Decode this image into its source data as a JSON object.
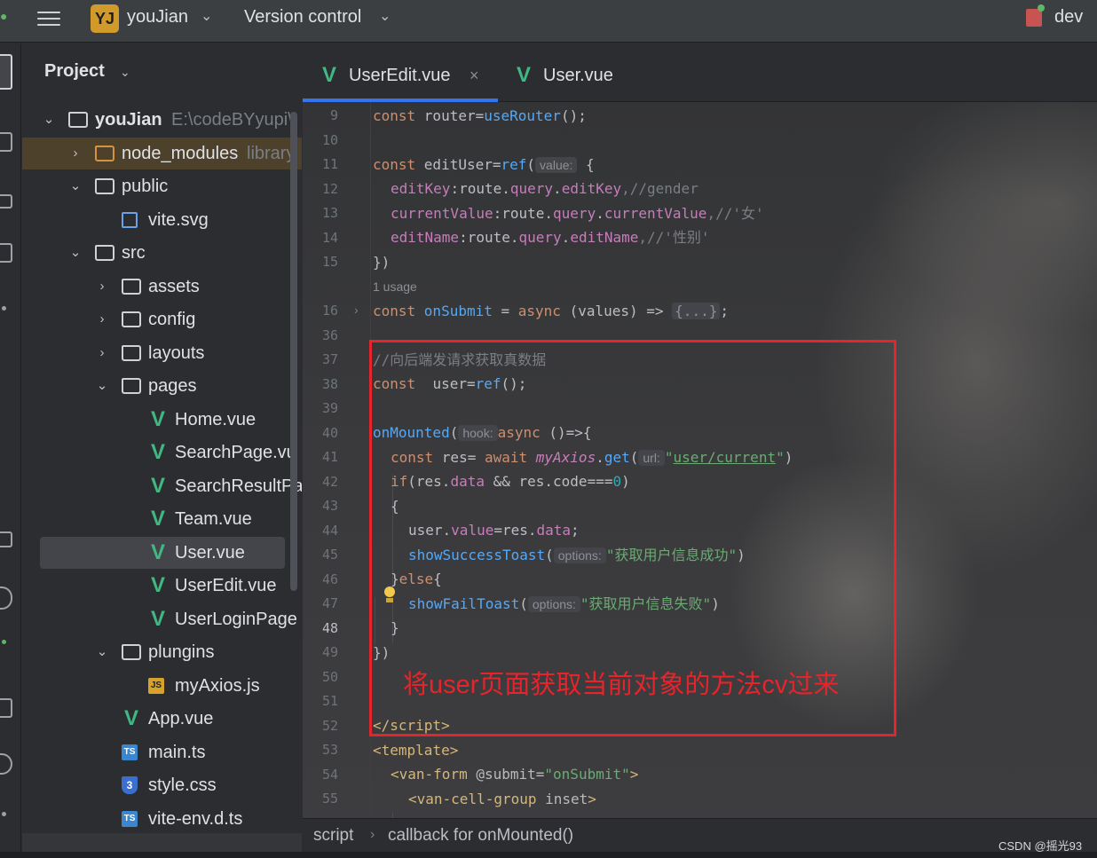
{
  "titlebar": {
    "project_initials": "YJ",
    "project_name": "youJian",
    "vcs_menu": "Version control",
    "branch": "dev"
  },
  "project_panel": {
    "title": "Project",
    "tree": [
      {
        "label": "youJian",
        "hint": "E:\\codeBYyupi\\",
        "type": "folder",
        "depth": 0,
        "expanded": true,
        "bold": true
      },
      {
        "label": "node_modules",
        "hint": "library",
        "type": "folder-excluded",
        "depth": 1,
        "expanded": false
      },
      {
        "label": "public",
        "type": "folder",
        "depth": 1,
        "expanded": true
      },
      {
        "label": "vite.svg",
        "type": "svg",
        "depth": 2
      },
      {
        "label": "src",
        "type": "folder",
        "depth": 1,
        "expanded": true
      },
      {
        "label": "assets",
        "type": "folder",
        "depth": 2,
        "expanded": false
      },
      {
        "label": "config",
        "type": "folder",
        "depth": 2,
        "expanded": false
      },
      {
        "label": "layouts",
        "type": "folder",
        "depth": 2,
        "expanded": false
      },
      {
        "label": "pages",
        "type": "folder",
        "depth": 2,
        "expanded": true
      },
      {
        "label": "Home.vue",
        "type": "vue",
        "depth": 3
      },
      {
        "label": "SearchPage.vu",
        "type": "vue",
        "depth": 3
      },
      {
        "label": "SearchResultPa",
        "type": "vue",
        "depth": 3
      },
      {
        "label": "Team.vue",
        "type": "vue",
        "depth": 3
      },
      {
        "label": "User.vue",
        "type": "vue",
        "depth": 3,
        "selected": true
      },
      {
        "label": "UserEdit.vue",
        "type": "vue",
        "depth": 3
      },
      {
        "label": "UserLoginPage",
        "type": "vue",
        "depth": 3
      },
      {
        "label": "plungins",
        "type": "folder",
        "depth": 2,
        "expanded": true
      },
      {
        "label": "myAxios.js",
        "type": "js",
        "depth": 3
      },
      {
        "label": "App.vue",
        "type": "vue",
        "depth": 2
      },
      {
        "label": "main.ts",
        "type": "ts",
        "depth": 2
      },
      {
        "label": "style.css",
        "type": "css",
        "depth": 2
      },
      {
        "label": "vite-env.d.ts",
        "type": "ts",
        "depth": 2
      }
    ]
  },
  "tabs": [
    {
      "label": "UserEdit.vue",
      "active": true,
      "close": "×"
    },
    {
      "label": "User.vue",
      "active": false
    }
  ],
  "editor": {
    "line_numbers": [
      "9",
      "10",
      "11",
      "12",
      "13",
      "14",
      "15",
      "",
      "16",
      "36",
      "37",
      "38",
      "39",
      "40",
      "41",
      "42",
      "43",
      "44",
      "45",
      "46",
      "47",
      "48",
      "49",
      "50",
      "51",
      "52",
      "53",
      "54",
      "55"
    ],
    "usage_hint": "1 usage",
    "hints": {
      "value": "value:",
      "hook": "hook:",
      "url": "url:",
      "options": "options:"
    },
    "code": {
      "l9_a": "const ",
      "l9_b": "router=",
      "l9_c": "useRouter",
      "l9_d": "();",
      "l11_a": "const ",
      "l11_b": "editUser=",
      "l11_c": "ref",
      "l11_d": "(",
      "l11_e": " {",
      "l12_a": "editKey",
      "l12_b": ":route.",
      "l12_c": "query",
      "l12_d": ".",
      "l12_e": "editKey",
      "l12_f": ",//gender",
      "l13_a": "currentValue",
      "l13_b": ":route.",
      "l13_c": "query",
      "l13_d": ".",
      "l13_e": "currentValue",
      "l13_f": ",//'女'",
      "l14_a": "editName",
      "l14_b": ":route.",
      "l14_c": "query",
      "l14_d": ".",
      "l14_e": "editName",
      "l14_f": ",//'性别'",
      "l15": "})",
      "l16_a": "const ",
      "l16_b": "onSubmit",
      "l16_c": " = ",
      "l16_d": "async",
      "l16_e": " (values) => ",
      "l16_f": "{...}",
      "l16_g": ";",
      "l37": "//向后端发请求获取真数据",
      "l38_a": "const  ",
      "l38_b": "user=",
      "l38_c": "ref",
      "l38_d": "();",
      "l40_a": "onMounted",
      "l40_b": "(",
      "l40_c": "async",
      "l40_d": " ()=>{",
      "l41_a": "const ",
      "l41_b": "res= ",
      "l41_c": "await ",
      "l41_d": "myAxios",
      "l41_e": ".",
      "l41_f": "get",
      "l41_g": "(",
      "l41_h": "\"",
      "l41_i": "user/current",
      "l41_j": "\"",
      "l41_k": ")",
      "l42_a": "if",
      "l42_b": "(res.",
      "l42_c": "data",
      "l42_d": " && res.",
      "l42_e": "code",
      "l42_f": "===",
      "l42_g": "0",
      "l42_h": ")",
      "l43": "{",
      "l44_a": "user.",
      "l44_b": "value",
      "l44_c": "=res.",
      "l44_d": "data",
      "l44_e": ";",
      "l45_a": "showSuccessToast",
      "l45_b": "(",
      "l45_c": "\"获取用户信息成功\"",
      "l45_d": ")",
      "l46_a": "}",
      "l46_b": "else",
      "l46_c": "{",
      "l47_a": "showFailToast",
      "l47_b": "(",
      "l47_c": "\"获取用户信息失败\"",
      "l47_d": ")",
      "l48": "}",
      "l49": "})",
      "l52_a": "</",
      "l52_b": "script",
      "l52_c": ">",
      "l53_a": "<",
      "l53_b": "template",
      "l53_c": ">",
      "l54_a": "<",
      "l54_b": "van-form",
      "l54_c": " @submit=",
      "l54_d": "\"onSubmit\"",
      "l54_e": ">",
      "l55_a": "<",
      "l55_b": "van-cell-group",
      "l55_c": " inset",
      "l55_d": ">"
    }
  },
  "annotation": {
    "note": "将user页面获取当前对象的方法cv过来",
    "color": "#e5242b"
  },
  "statusbar": {
    "crumb1": "script",
    "crumb2": "callback for onMounted()"
  },
  "watermark": "CSDN @摇光93"
}
